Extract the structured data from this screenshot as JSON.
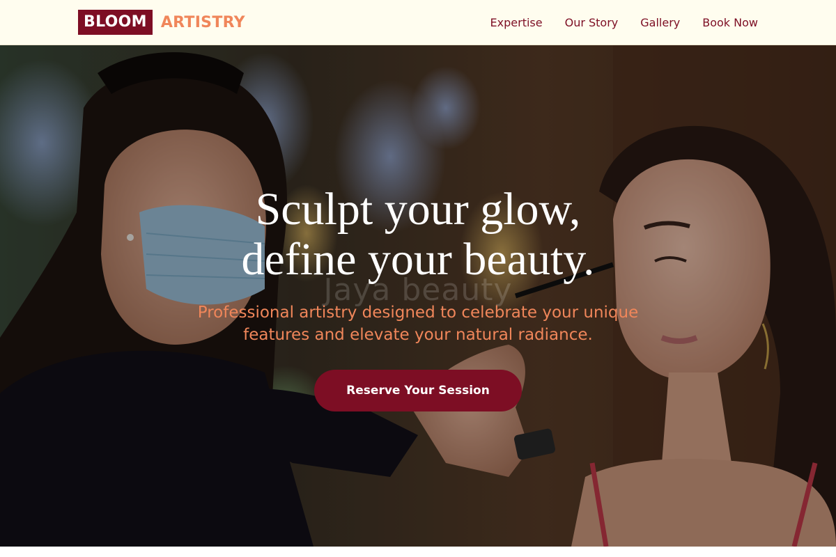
{
  "brand": {
    "name_boxed": "BLOOM",
    "name_text": "ARTISTRY",
    "primary_color": "#7d0e24",
    "accent_color": "#f0865a",
    "header_background": "#fffdef"
  },
  "nav": {
    "items": [
      {
        "label": "Expertise"
      },
      {
        "label": "Our Story"
      },
      {
        "label": "Gallery"
      },
      {
        "label": "Book Now"
      }
    ]
  },
  "hero": {
    "title_line_1": "Sculpt your glow,",
    "title_line_2": "define your beauty.",
    "subtitle": "Professional artistry designed to celebrate your unique features and elevate your natural radiance.",
    "cta_label": "Reserve Your Session",
    "watermark": "Jaya beauty",
    "image_description_icon": "photo-makeup-artist-applying-eyeliner"
  }
}
